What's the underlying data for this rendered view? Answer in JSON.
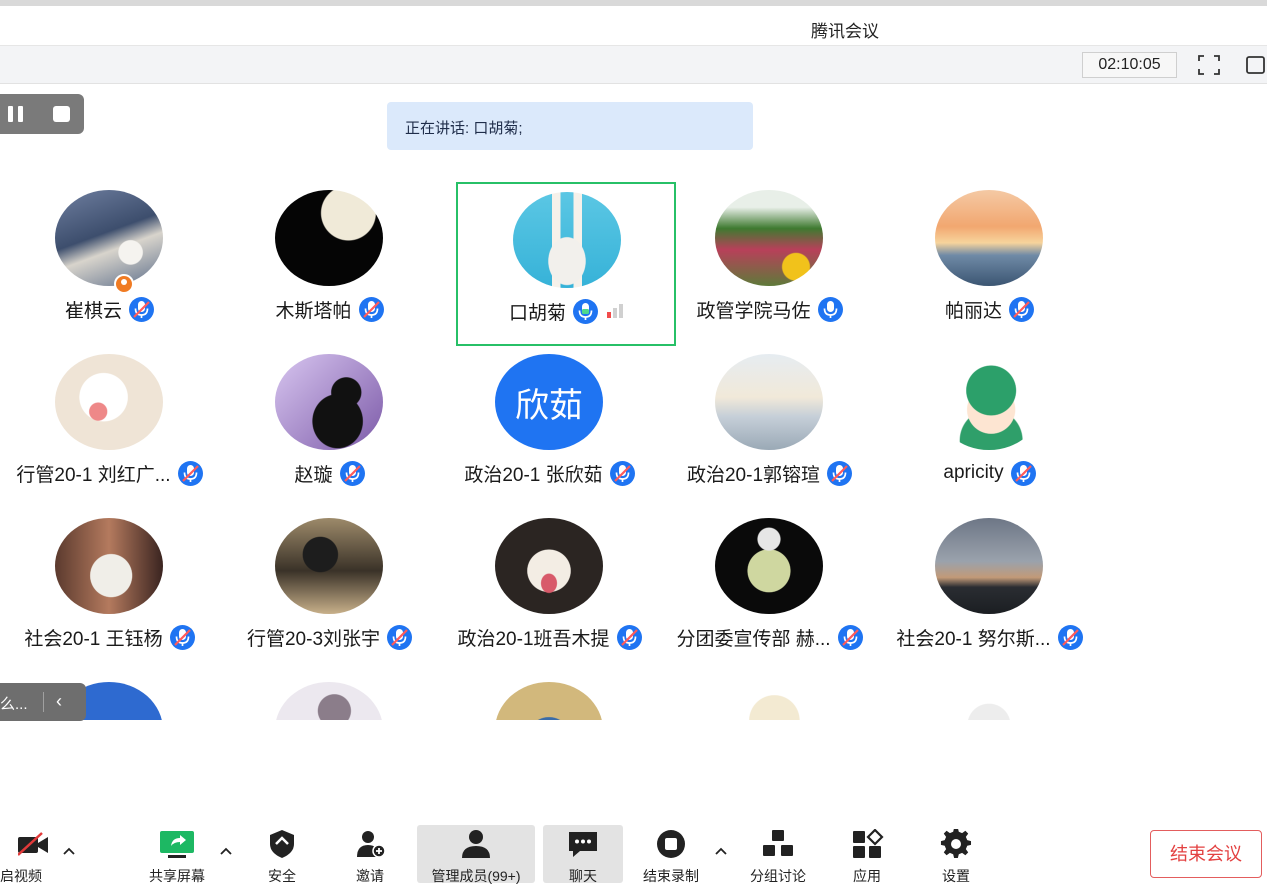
{
  "app": {
    "title": "腾讯会议"
  },
  "topbar": {
    "timer": "02:10:05"
  },
  "speaking": {
    "text": "正在讲话: 口胡菊;"
  },
  "participants": [
    {
      "name": "崔棋云",
      "mic": "muted",
      "host": true,
      "avatar": "eagle-photo"
    },
    {
      "name": "木斯塔帕",
      "mic": "muted",
      "avatar": "moon-photo"
    },
    {
      "name": "口胡菊",
      "mic": "speaking",
      "active": true,
      "avatar": "rabbit-illustration"
    },
    {
      "name": "政管学院马佐",
      "mic": "on",
      "avatar": "garden-photo"
    },
    {
      "name": "帕丽达",
      "mic": "muted",
      "avatar": "sunset-photo"
    },
    {
      "name": "行管20-1 刘红广...",
      "mic": "muted",
      "avatar": "cartoon-sheep"
    },
    {
      "name": "赵璇",
      "mic": "muted",
      "avatar": "silhouette-purple"
    },
    {
      "name": "政治20-1 张欣茹",
      "mic": "muted",
      "avatar": "text",
      "avatar_text": "欣茹"
    },
    {
      "name": "政治20-1郭镕瑄",
      "mic": "muted",
      "avatar": "clouds-photo"
    },
    {
      "name": "apricity",
      "mic": "muted",
      "avatar": "cartoon-boy"
    },
    {
      "name": "社会20-1 王钰杨",
      "mic": "muted",
      "avatar": "mask-person"
    },
    {
      "name": "行管20-3刘张宇",
      "mic": "muted",
      "avatar": "painting"
    },
    {
      "name": "政治20-1班吾木提",
      "mic": "muted",
      "avatar": "dog-photo"
    },
    {
      "name": "分团委宣传部 赫...",
      "mic": "muted",
      "avatar": "cartoon-zombie"
    },
    {
      "name": "社会20-1 努尔斯...",
      "mic": "muted",
      "avatar": "dusk-photo"
    },
    {
      "name": "",
      "avatar": "partial-1"
    },
    {
      "name": "",
      "avatar": "partial-2"
    },
    {
      "name": "",
      "avatar": "partial-3"
    },
    {
      "name": "",
      "avatar": "partial-4"
    },
    {
      "name": "",
      "avatar": "partial-5"
    }
  ],
  "sidebar_tab": {
    "text": "么...",
    "icon": "chevron-left-icon"
  },
  "toolbar": {
    "video": "启视频",
    "share": "共享屏幕",
    "security": "安全",
    "invite": "邀请",
    "members": "管理成员(99+)",
    "chat": "聊天",
    "end_record": "结束录制",
    "breakout": "分组讨论",
    "apps": "应用",
    "settings": "设置"
  },
  "end_meeting": "结束会议",
  "colors": {
    "accent": "#1f74f2",
    "active_border": "#27c067",
    "danger": "#e34141"
  }
}
